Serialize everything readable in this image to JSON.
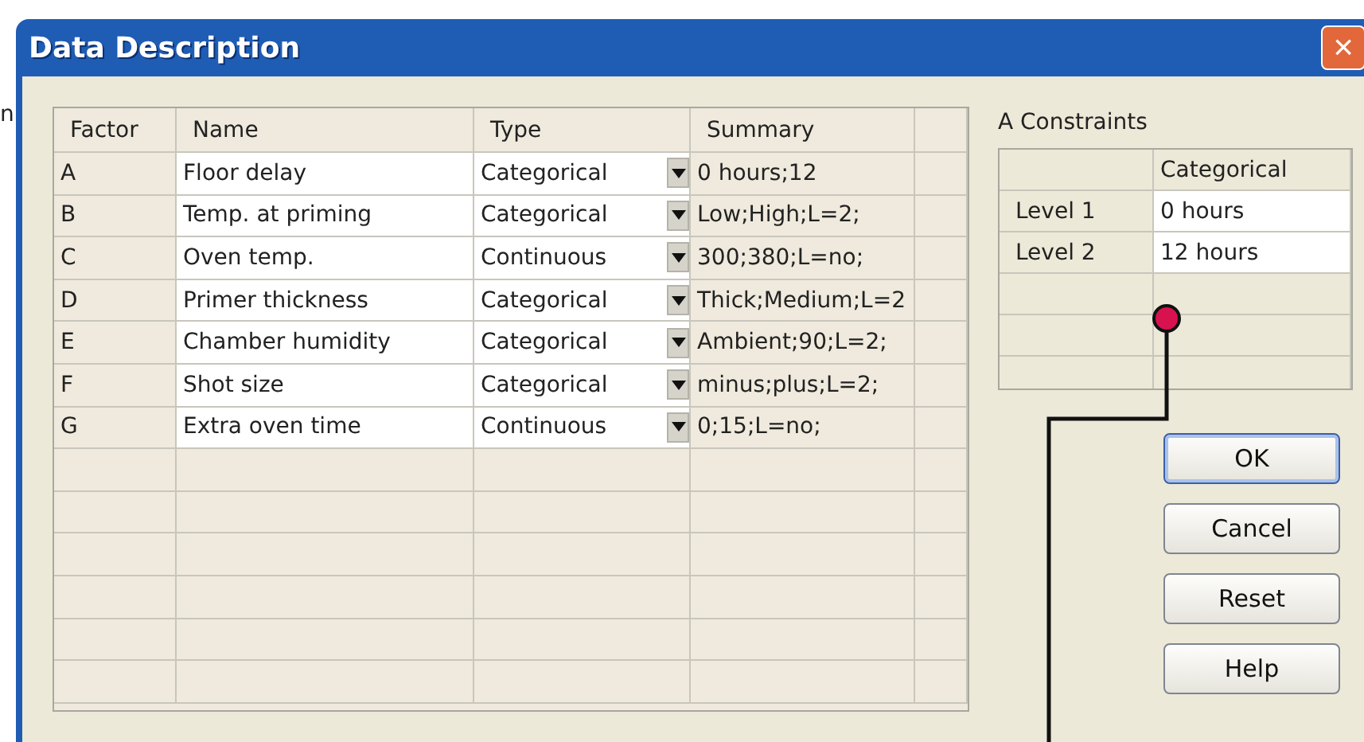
{
  "background_window": {
    "text_fragment": "n"
  },
  "window": {
    "title": "Data Description",
    "close": "×"
  },
  "factor_table": {
    "columns": [
      "Factor",
      "Name",
      "Type",
      "Summary"
    ],
    "rows": [
      {
        "factor": "A",
        "name": "Floor delay",
        "type": "Categorical",
        "summary": "0 hours;12"
      },
      {
        "factor": "B",
        "name": "Temp. at priming",
        "type": "Categorical",
        "summary": "Low;High;L=2;"
      },
      {
        "factor": "C",
        "name": "Oven temp.",
        "type": "Continuous",
        "summary": "300;380;L=no;"
      },
      {
        "factor": "D",
        "name": "Primer thickness",
        "type": "Categorical",
        "summary": "Thick;Medium;L=2"
      },
      {
        "factor": "E",
        "name": "Chamber humidity",
        "type": "Categorical",
        "summary": "Ambient;90;L=2;"
      },
      {
        "factor": "F",
        "name": "Shot size",
        "type": "Categorical",
        "summary": "minus;plus;L=2;"
      },
      {
        "factor": "G",
        "name": "Extra oven time",
        "type": "Continuous",
        "summary": "0;15;L=no;"
      }
    ]
  },
  "constraints": {
    "title": "A Constraints",
    "column": "Categorical",
    "rows": [
      {
        "label": "Level 1",
        "value": "0 hours"
      },
      {
        "label": "Level 2",
        "value": "12 hours"
      }
    ]
  },
  "buttons": [
    {
      "label": "OK",
      "default": true
    },
    {
      "label": "Cancel",
      "default": false
    },
    {
      "label": "Reset",
      "default": false
    },
    {
      "label": "Help",
      "default": false
    }
  ]
}
